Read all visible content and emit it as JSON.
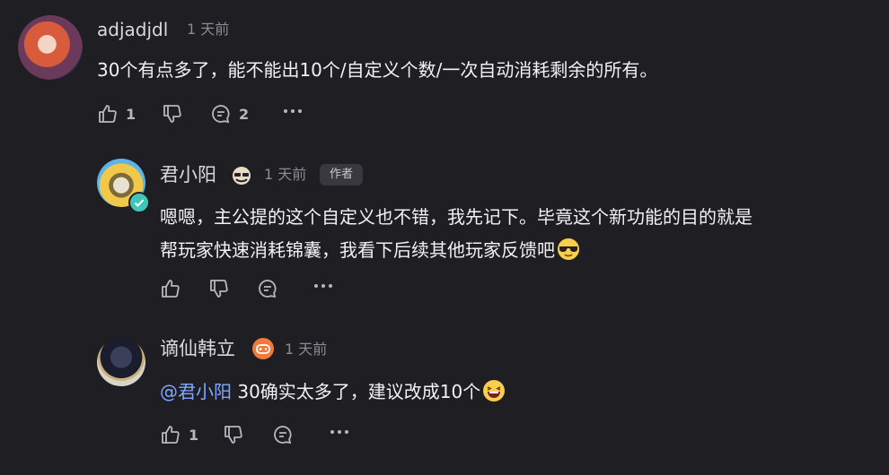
{
  "comments": [
    {
      "username": "adjadjdl",
      "time": "1 天前",
      "text": "30个有点多了，能不能出10个/自定义个数/一次自动消耗剩余的所有。",
      "likes": "1",
      "replies": "2"
    },
    {
      "username": "君小阳",
      "time": "1 天前",
      "author_badge": "作者",
      "text_line1": "嗯嗯，主公提的这个自定义也不错，我先记下。毕竟这个新功能的目的就是",
      "text_line2": "帮玩家快速消耗锦囊，我看下后续其他玩家反馈吧"
    },
    {
      "username": "谪仙韩立",
      "time": "1 天前",
      "mention": "@君小阳",
      "text": " 30确实太多了，建议改成10个",
      "likes": "1"
    }
  ],
  "colors": {
    "background": "#1e1e23",
    "mention": "#7fa9ff",
    "verified": "#3fc6b8",
    "game_badge": "#f07a3a"
  },
  "icons": [
    "thumbs-up-icon",
    "thumbs-down-icon",
    "comment-icon",
    "more-icon",
    "verified-icon",
    "game-badge-icon",
    "glasses-badge-icon",
    "sunglasses-emoji",
    "grin-emoji"
  ]
}
